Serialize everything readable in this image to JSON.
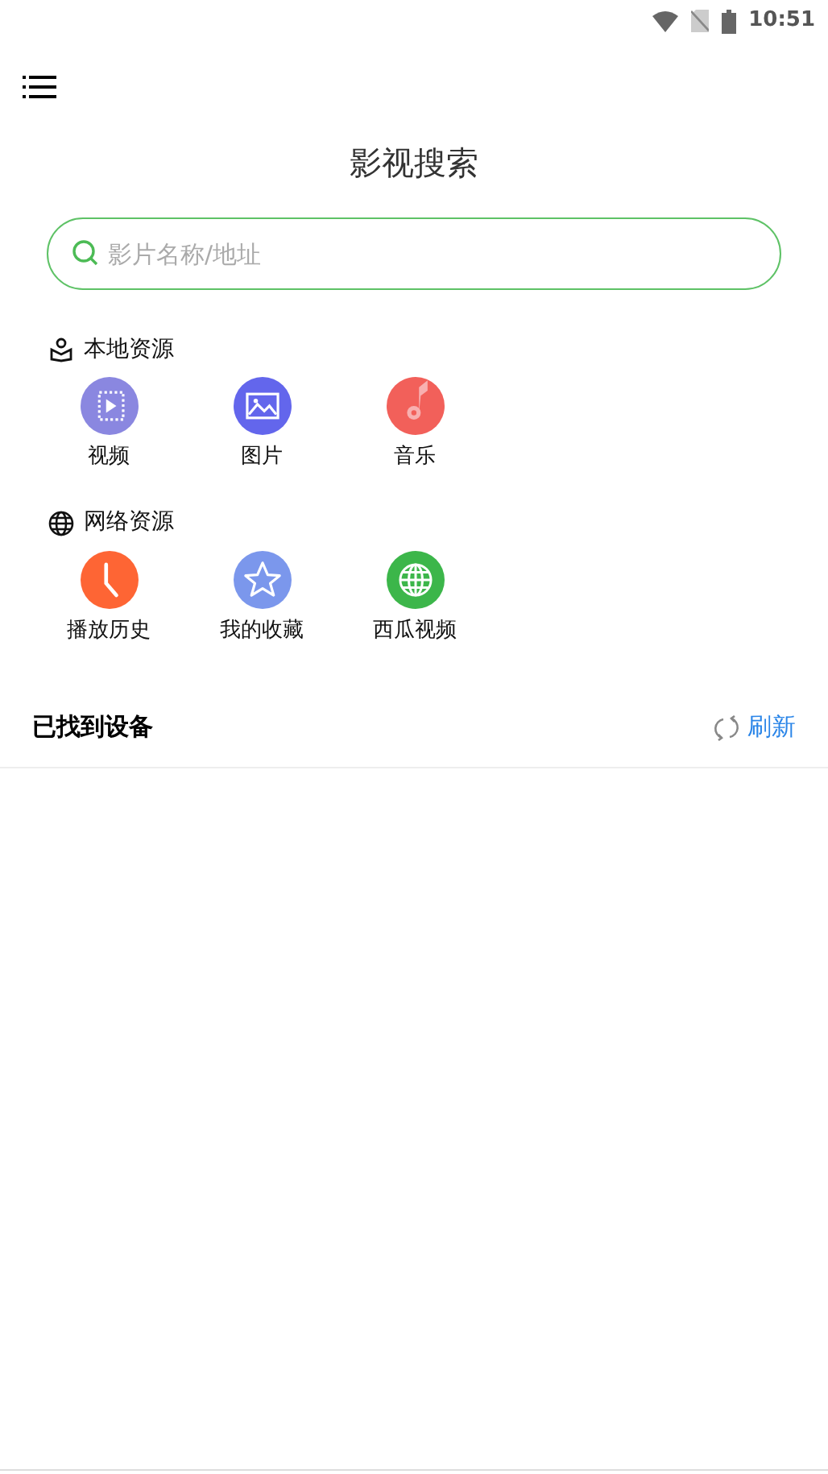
{
  "status_bar": {
    "time": "10:51"
  },
  "title": "影视搜索",
  "search": {
    "placeholder": "影片名称/地址"
  },
  "sections": [
    {
      "title": "本地资源",
      "kind": "local",
      "items": [
        {
          "label": "视频",
          "kind": "video",
          "color": "#8a87e0"
        },
        {
          "label": "图片",
          "kind": "image",
          "color": "#6366ec"
        },
        {
          "label": "音乐",
          "kind": "music",
          "color": "#f2605a"
        }
      ]
    },
    {
      "title": "网络资源",
      "kind": "network",
      "items": [
        {
          "label": "播放历史",
          "kind": "history",
          "color": "#fe6534"
        },
        {
          "label": "我的收藏",
          "kind": "favorite",
          "color": "#7b97ec"
        },
        {
          "label": "西瓜视频",
          "kind": "web",
          "color": "#3cb64a"
        }
      ]
    }
  ],
  "devices": {
    "title": "已找到设备",
    "refresh": "刷新"
  }
}
